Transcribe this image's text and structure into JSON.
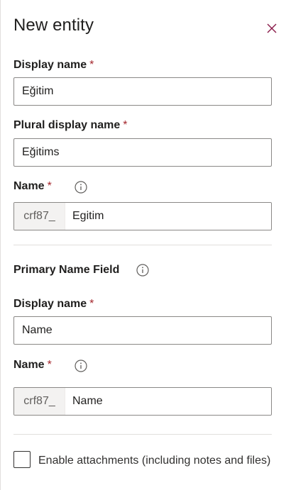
{
  "header": {
    "title": "New entity",
    "close_icon": "close-icon"
  },
  "display_name": {
    "label": "Display name",
    "required_mark": "*",
    "value": "Eğitim"
  },
  "plural_display_name": {
    "label": "Plural display name",
    "required_mark": "*",
    "value": "Eğitims"
  },
  "name": {
    "label": "Name",
    "required_mark": "*",
    "info_icon": "info-icon",
    "prefix": "crf87_",
    "value": "Egitim"
  },
  "primary_name_field": {
    "section_title": "Primary Name Field",
    "info_icon": "info-icon",
    "display_name": {
      "label": "Display name",
      "required_mark": "*",
      "value": "Name"
    },
    "name": {
      "label": "Name",
      "required_mark": "*",
      "info_icon": "info-icon",
      "prefix": "crf87_",
      "value": "Name"
    }
  },
  "attachments": {
    "checked": false,
    "label": "Enable attachments (including notes and files)"
  },
  "colors": {
    "required": "#a4262c",
    "close_icon": "#8a1c4b",
    "border": "#8a8886",
    "prefix_bg": "#f3f2f1"
  }
}
